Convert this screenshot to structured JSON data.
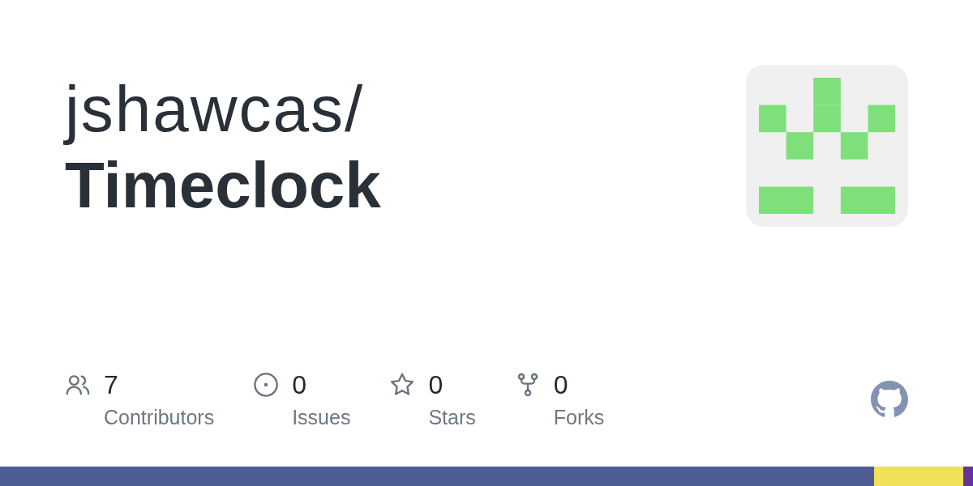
{
  "repository": {
    "owner": "jshawcas/",
    "name": "Timeclock"
  },
  "stats": [
    {
      "kind": "contributors",
      "value": "7",
      "label": "Contributors"
    },
    {
      "kind": "issues",
      "value": "0",
      "label": "Issues"
    },
    {
      "kind": "stars",
      "value": "0",
      "label": "Stars"
    },
    {
      "kind": "forks",
      "value": "0",
      "label": "Forks"
    }
  ],
  "language_bar": [
    {
      "color": "#4f5d95"
    },
    {
      "color": "#f1e05a"
    },
    {
      "color": "#663399"
    }
  ]
}
